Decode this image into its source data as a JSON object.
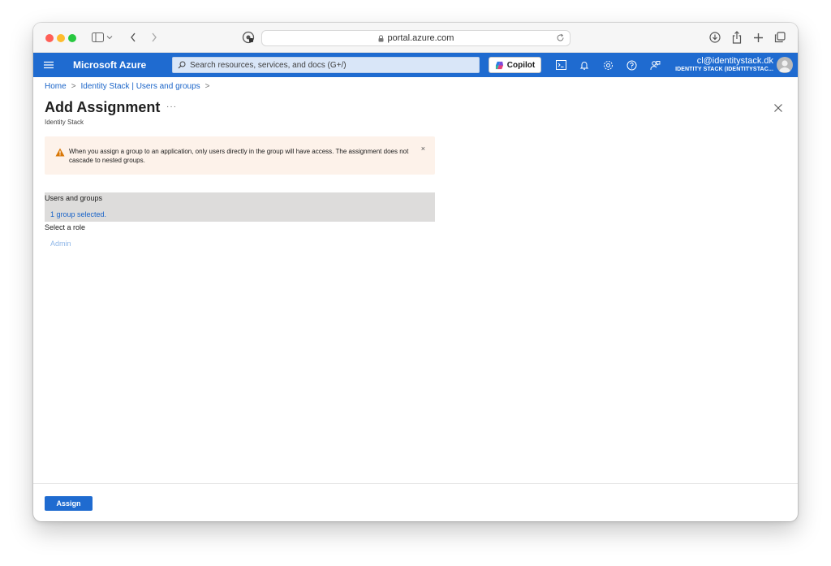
{
  "browser": {
    "url": "portal.azure.com"
  },
  "header": {
    "brand": "Microsoft Azure",
    "search_placeholder": "Search resources, services, and docs (G+/)",
    "copilot_label": "Copilot",
    "account_email": "cl@identitystack.dk",
    "account_directory": "IDENTITY STACK (IDENTITYSTAC..."
  },
  "breadcrumb": {
    "home": "Home",
    "parent": "Identity Stack | Users and groups"
  },
  "page": {
    "title": "Add Assignment",
    "more": "···",
    "subtitle": "Identity Stack"
  },
  "warning": {
    "text": "When you assign a group to an application, only users directly in the group will have access. The assignment does not cascade to nested groups.",
    "close": "×"
  },
  "form": {
    "users_groups_label": "Users and groups",
    "users_groups_value": "1 group selected.",
    "role_label": "Select a role",
    "role_value": "Admin"
  },
  "footer": {
    "assign_label": "Assign"
  },
  "colors": {
    "azure_blue": "#1f6bd0",
    "link_blue": "#1a64c8",
    "warning_bg": "#fdf2ea",
    "warning_icon": "#d97706"
  }
}
